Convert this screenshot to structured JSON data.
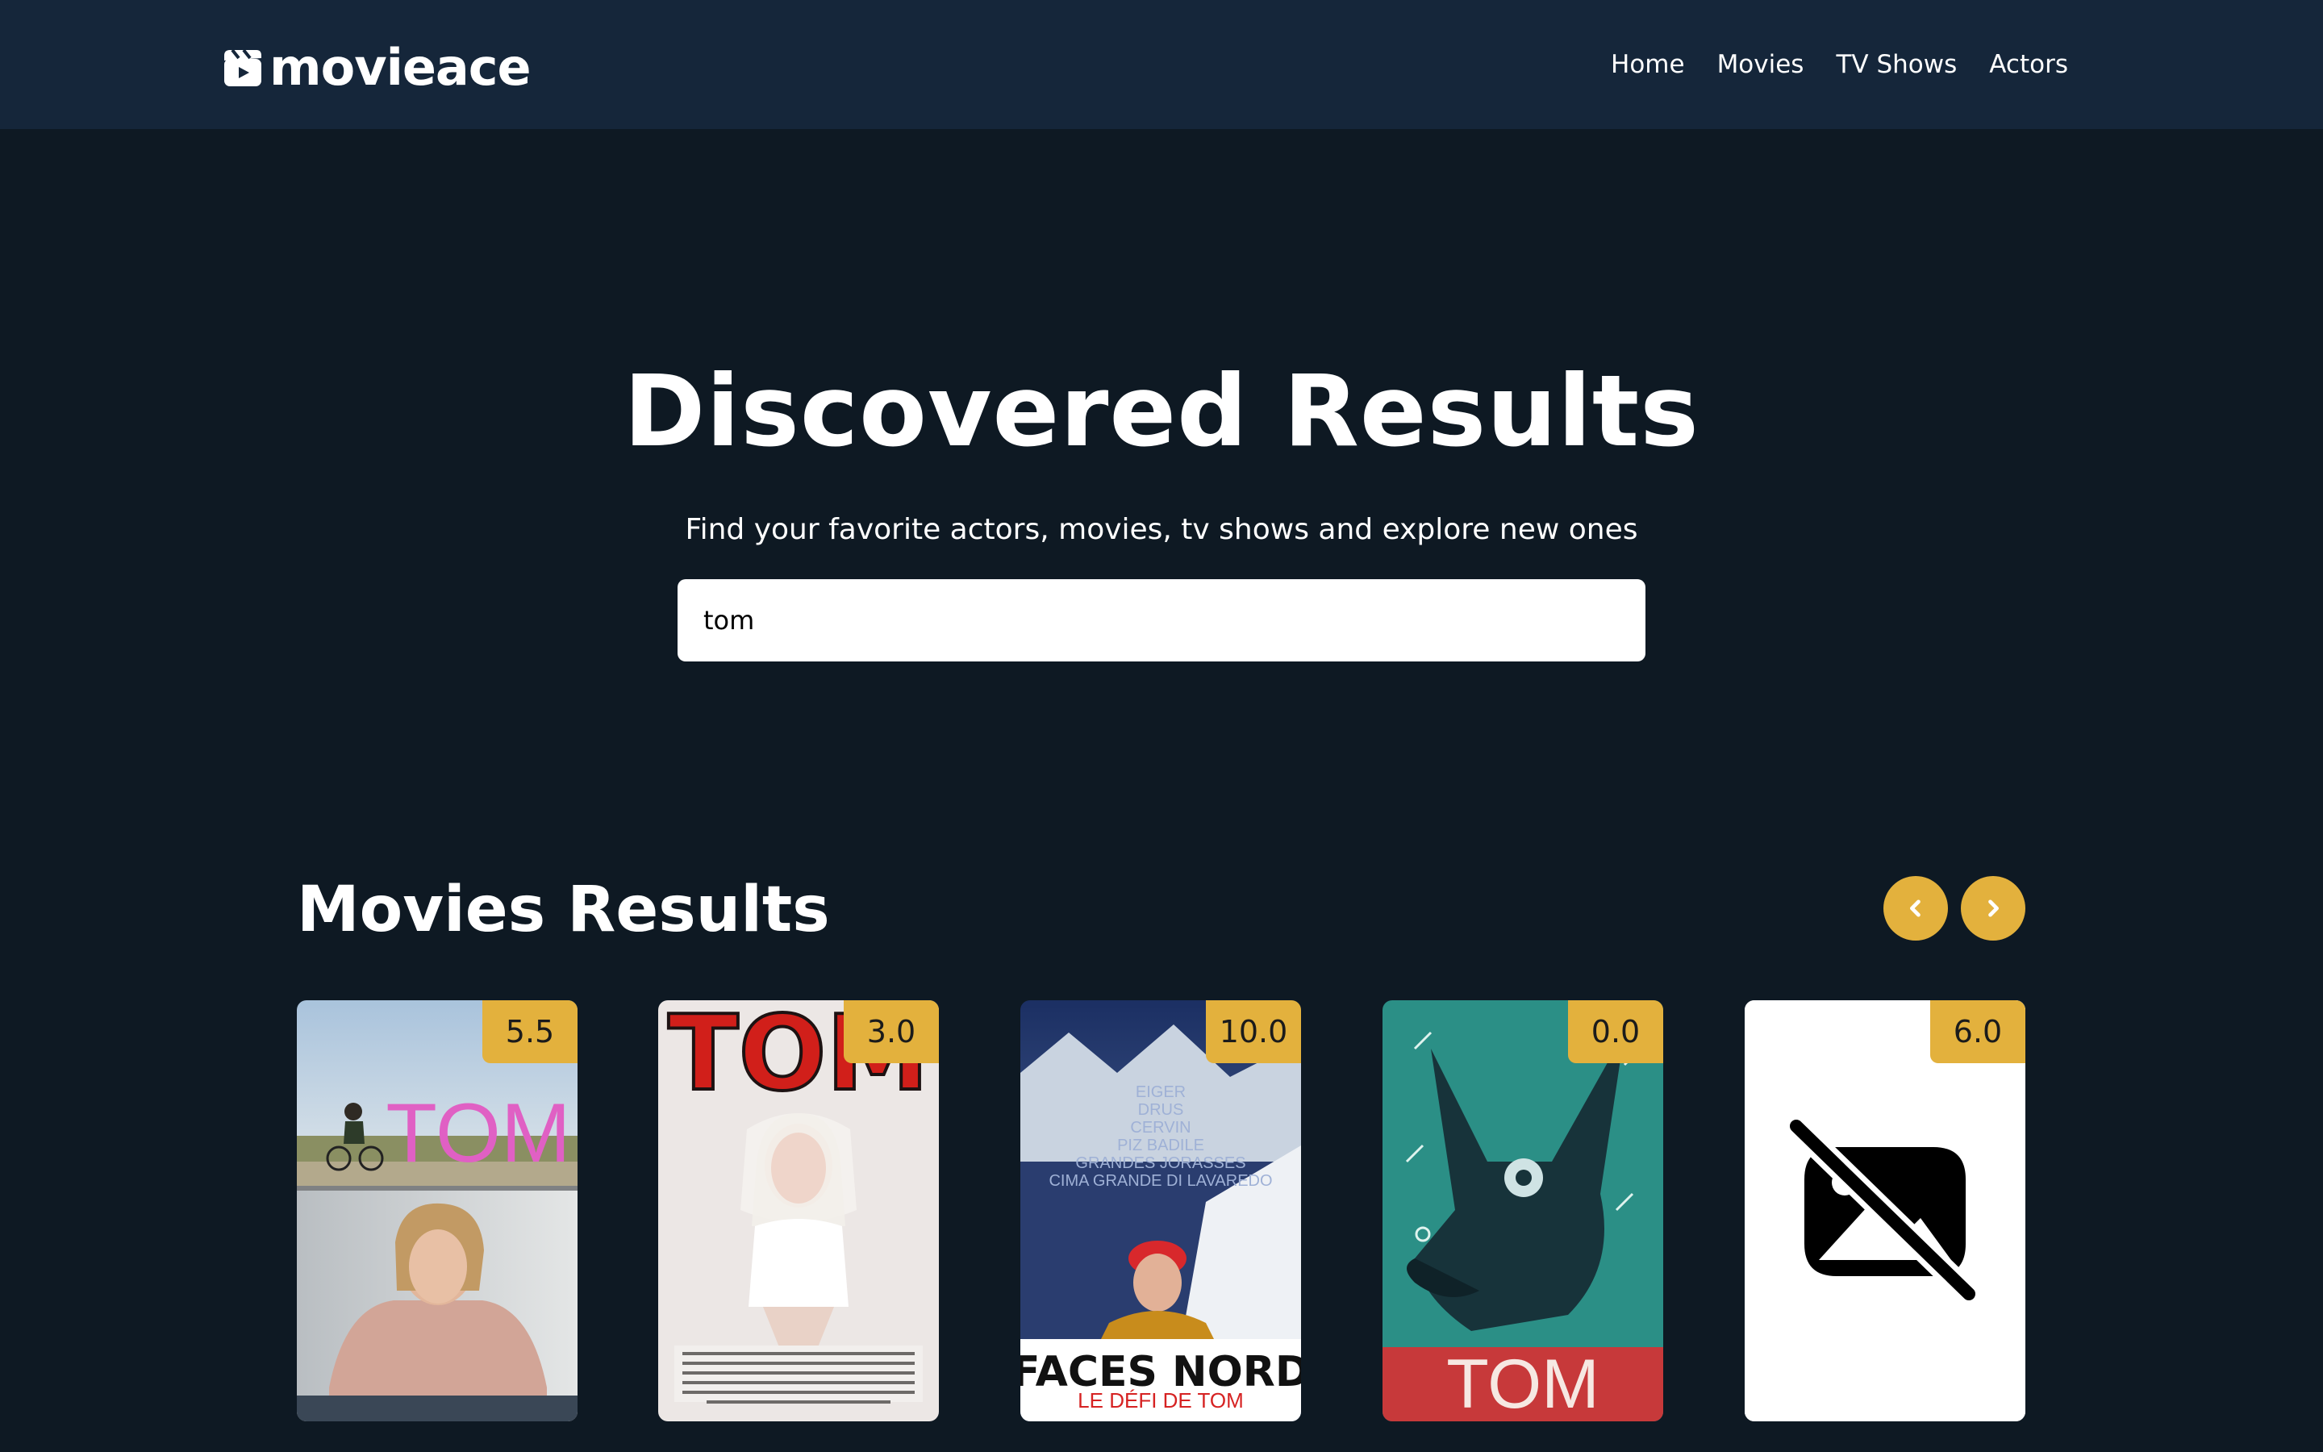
{
  "brand": {
    "name": "movieace"
  },
  "nav": {
    "items": [
      {
        "label": "Home"
      },
      {
        "label": "Movies"
      },
      {
        "label": "TV Shows"
      },
      {
        "label": "Actors"
      }
    ]
  },
  "hero": {
    "title": "Discovered Results",
    "subtitle": "Find your favorite actors, movies, tv shows and explore new ones",
    "search_value": "tom"
  },
  "results": {
    "section_title": "Movies Results",
    "prev_icon": "chevron-left-icon",
    "next_icon": "chevron-right-icon",
    "movies": [
      {
        "rating": "5.5",
        "poster_text": "TOM"
      },
      {
        "rating": "3.0",
        "poster_text": "TOM"
      },
      {
        "rating": "10.0",
        "poster_text": "FACES NORD",
        "poster_subtext": "LE DÉFI DE TOM",
        "poster_peaks": [
          "EIGER",
          "DRUS",
          "CERVIN",
          "PIZ BADILE",
          "GRANDES JORASSES",
          "CIMA GRANDE DI LAVAREDO"
        ]
      },
      {
        "rating": "0.0",
        "poster_text": "TOM"
      },
      {
        "rating": "6.0",
        "poster_icon": "image-off-icon"
      }
    ]
  },
  "colors": {
    "background": "#0e1923",
    "navbar": "#15263a",
    "accent": "#e3b13d"
  }
}
